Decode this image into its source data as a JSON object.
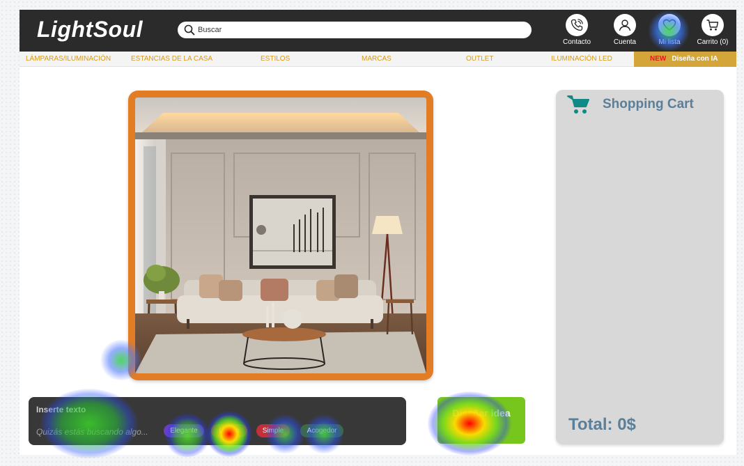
{
  "header": {
    "logo": "LightSoul",
    "search": {
      "placeholder": "Buscar",
      "value": ""
    },
    "actions": [
      {
        "label": "Contacto",
        "icon": "phone-icon"
      },
      {
        "label": "Cuenta",
        "icon": "user-icon"
      },
      {
        "label": "Mi lista",
        "icon": "heart-icon"
      },
      {
        "label": "Carrito (0)",
        "icon": "shopping-cart-icon"
      }
    ]
  },
  "nav": {
    "items": [
      {
        "label": "LÁMPARAS/ILUMINACIÓN"
      },
      {
        "label": "ESTANCIAS DE LA CASA"
      },
      {
        "label": "ESTILOS"
      },
      {
        "label": "MARCAS"
      },
      {
        "label": "OUTLET"
      },
      {
        "label": "ILUMINACIÓN LED"
      }
    ],
    "ia": {
      "badge": "NEW",
      "label": "Diseña con IA"
    }
  },
  "cart": {
    "title": "Shopping Cart",
    "icon": "shopping-cart-icon",
    "total": "Total: 0$"
  },
  "prompt": {
    "label": "Inserte texto",
    "placeholder": "Quizás estás buscando algo...",
    "value": "",
    "chips": [
      {
        "label": "Elegante",
        "color": "#6a3fc1"
      },
      {
        "label": "Lujoso",
        "color": "#c23b22"
      },
      {
        "label": "Simple",
        "color": "#c4303a"
      },
      {
        "label": "Acogedor",
        "color": "#3e6b3e"
      }
    ]
  },
  "design_button": {
    "label": "Diseñar idea"
  },
  "colors": {
    "header_bg": "#2b2b2b",
    "accent_gold": "#d49a1d",
    "image_frame": "#e27d25",
    "cart_bg": "#d8d8d8",
    "cart_text": "#5b7f98",
    "design_button": "#77c61d",
    "new_badge": "#e31b1b"
  },
  "overlay": {
    "type": "attention heatmap"
  }
}
